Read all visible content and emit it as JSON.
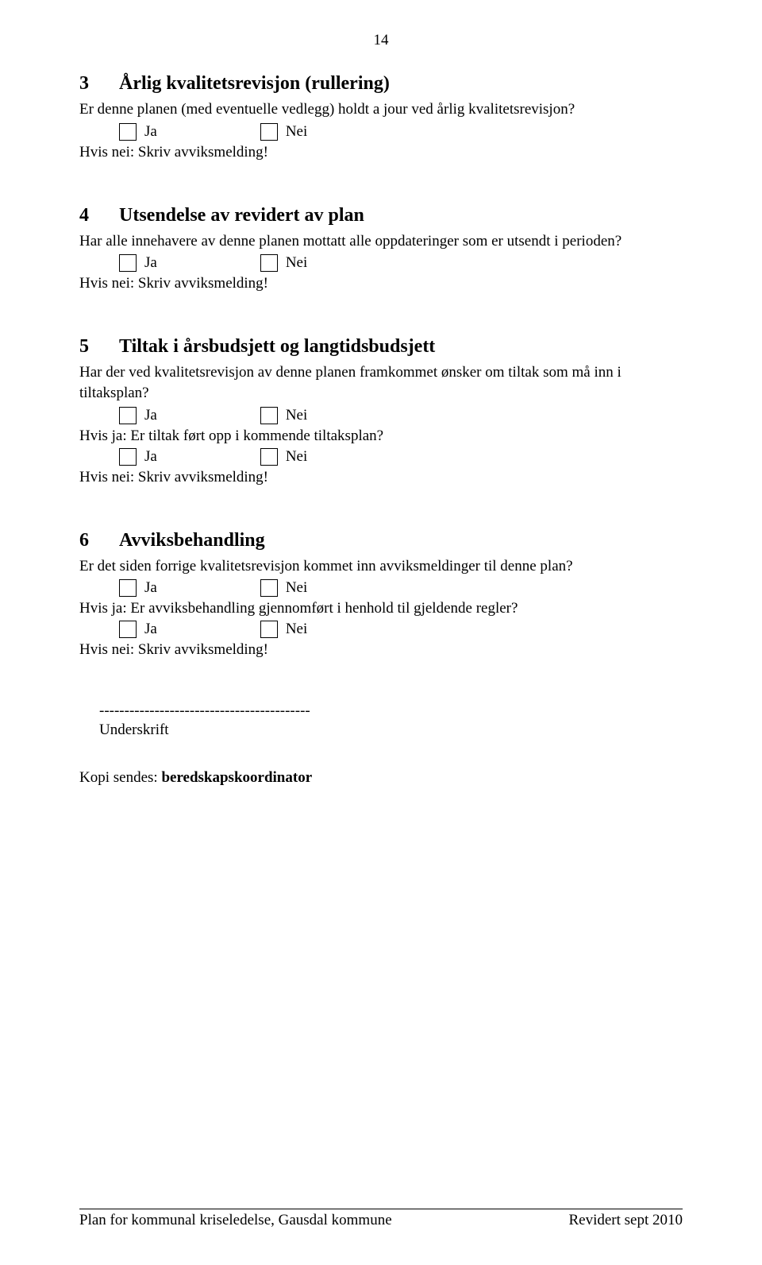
{
  "page_number": "14",
  "sections": {
    "s3": {
      "num": "3",
      "title": "Årlig kvalitetsrevisjon (rullering)",
      "question": "Er denne planen (med eventuelle vedlegg) holdt a jour ved årlig kvalitetsrevisjon?",
      "ja": "Ja",
      "nei": "Nei",
      "instruction": "Hvis nei:  Skriv avviksmelding!"
    },
    "s4": {
      "num": "4",
      "title": "Utsendelse av revidert av plan",
      "question": "Har alle innehavere av denne planen mottatt alle oppdateringer som er utsendt i perioden?",
      "ja": "Ja",
      "nei": "Nei",
      "instruction": "Hvis nei: Skriv avviksmelding!"
    },
    "s5": {
      "num": "5",
      "title": "Tiltak i årsbudsjett og langtidsbudsjett",
      "question": "Har der ved kvalitetsrevisjon av denne planen framkommet ønsker om tiltak som må inn i tiltaksplan?",
      "ja1": "Ja",
      "nei1": "Nei",
      "followup": "Hvis ja:  Er tiltak ført opp i kommende tiltaksplan?",
      "ja2": "Ja",
      "nei2": "Nei",
      "instruction": "Hvis nei: Skriv avviksmelding!"
    },
    "s6": {
      "num": "6",
      "title": "Avviksbehandling",
      "question": "Er det siden forrige kvalitetsrevisjon kommet inn avviksmeldinger til denne plan?",
      "ja1": "Ja",
      "nei1": "Nei",
      "followup": "Hvis ja:  Er avviksbehandling gjennomført i henhold til gjeldende regler?",
      "ja2": "Ja",
      "nei2": "Nei",
      "instruction": "Hvis nei: Skriv avviksmelding!"
    }
  },
  "signature": {
    "line": "------------------------------------------",
    "label": "Underskrift"
  },
  "copy": {
    "prefix": "Kopi sendes: ",
    "recipient": "beredskapskoordinator"
  },
  "footer": {
    "left": "Plan for kommunal kriseledelse, Gausdal kommune",
    "right": "Revidert sept 2010"
  }
}
